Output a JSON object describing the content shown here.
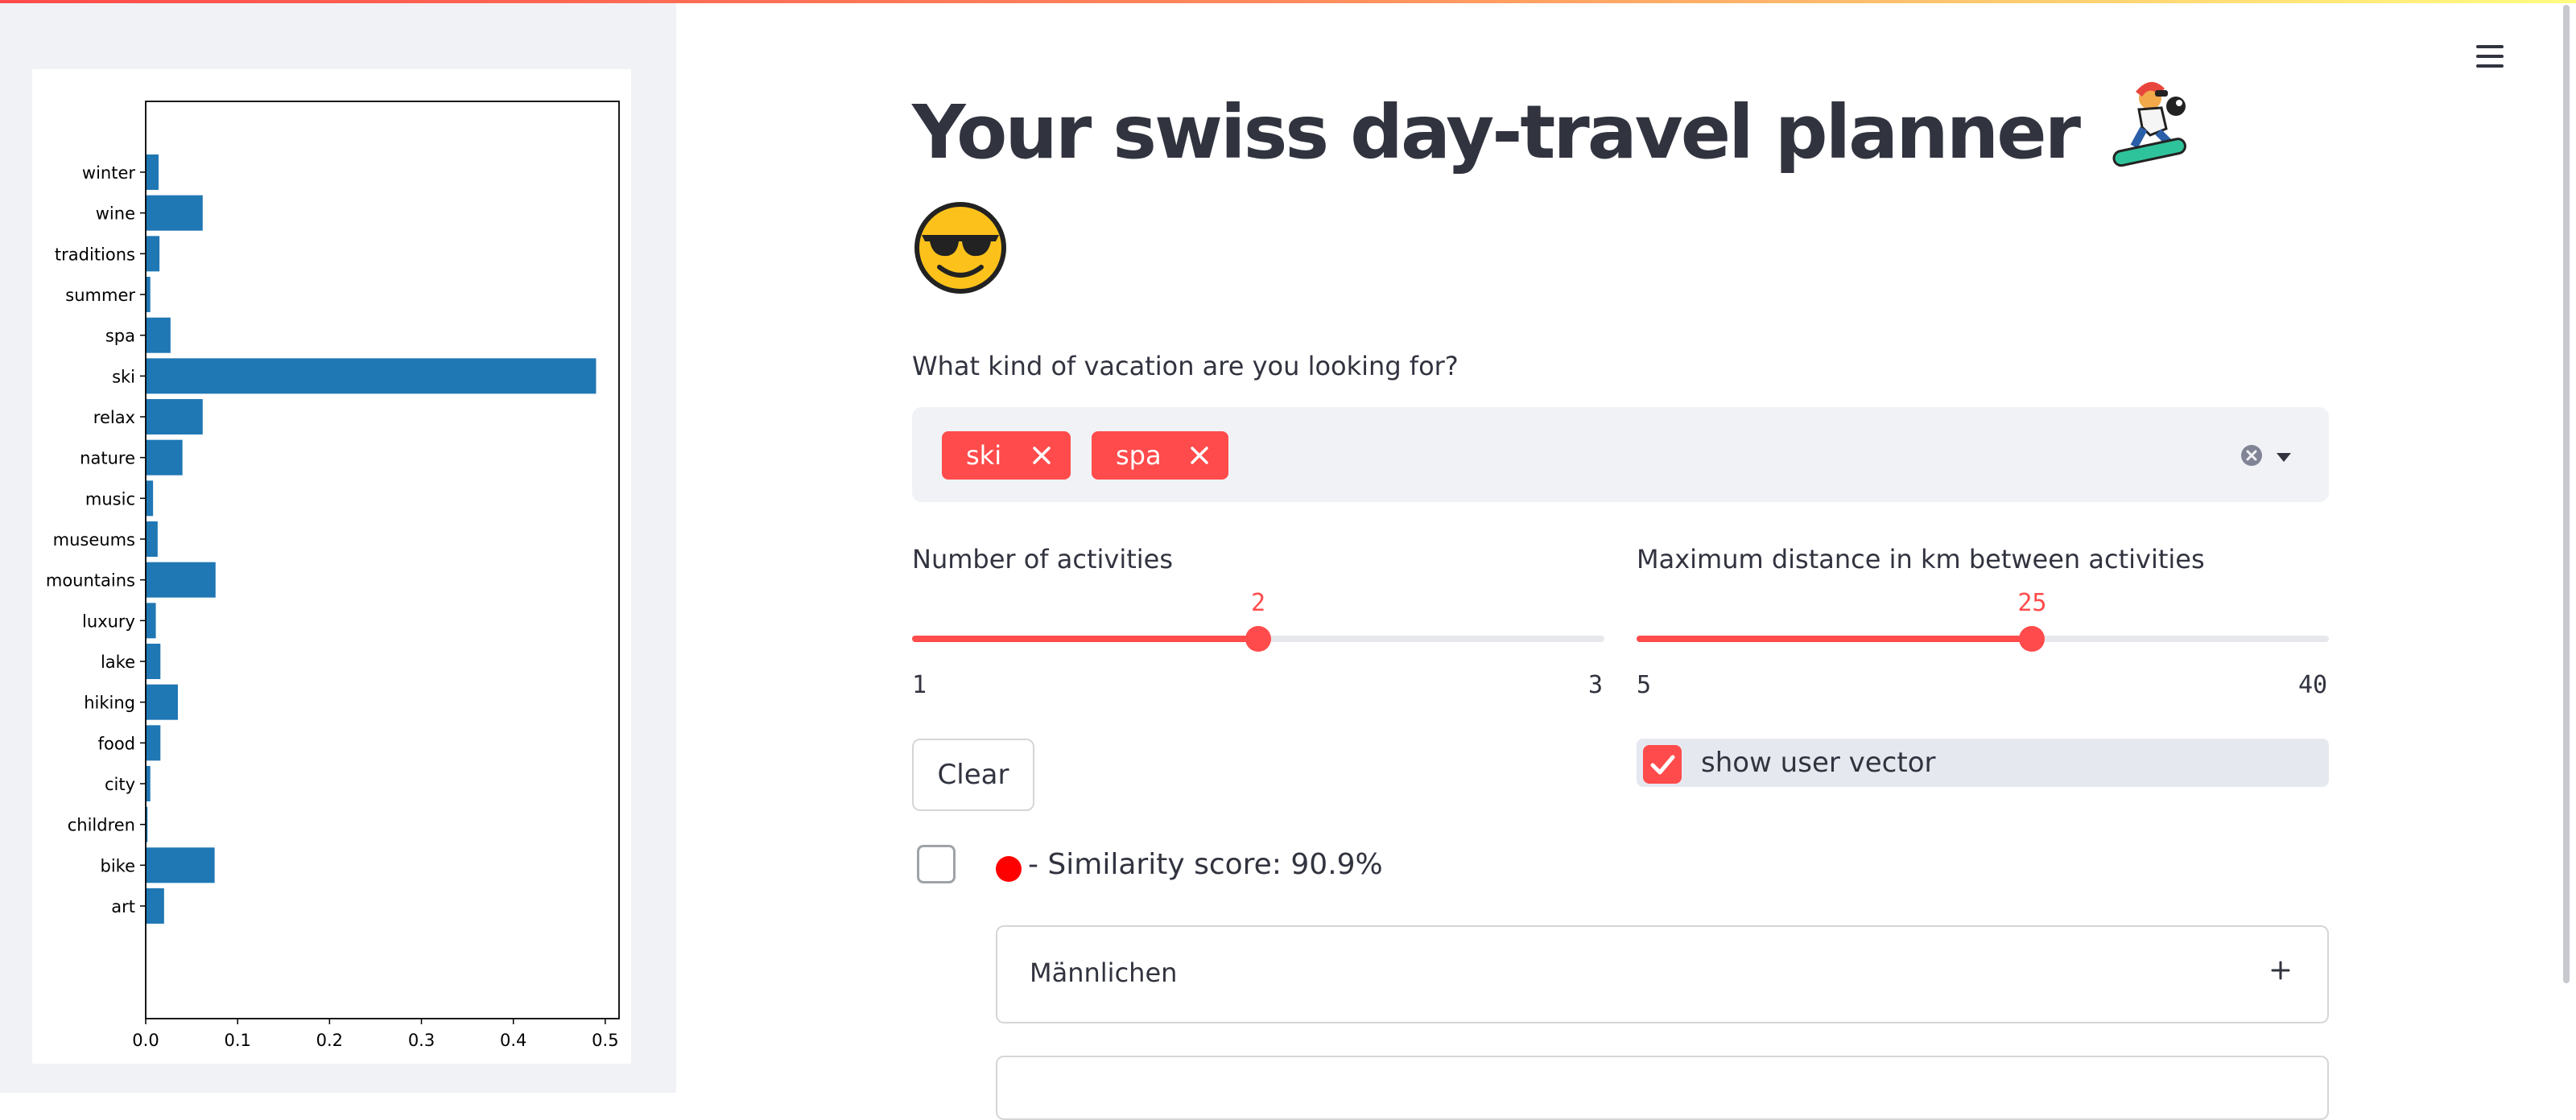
{
  "app": {
    "title": "Your swiss day-travel planner",
    "title_emoji_1": "snowboarder",
    "title_emoji_2": "smiling-face-with-sunglasses",
    "accent_color": "#ff4b4b"
  },
  "sidebar": {
    "chart_data": {
      "type": "bar",
      "orientation": "horizontal",
      "categories": [
        "winter",
        "wine",
        "traditions",
        "summer",
        "spa",
        "ski",
        "relax",
        "nature",
        "music",
        "museums",
        "mountains",
        "luxury",
        "lake",
        "hiking",
        "food",
        "city",
        "children",
        "bike",
        "art"
      ],
      "values": [
        0.014,
        0.062,
        0.015,
        0.005,
        0.027,
        0.49,
        0.062,
        0.04,
        0.008,
        0.013,
        0.076,
        0.011,
        0.016,
        0.035,
        0.016,
        0.005,
        0.002,
        0.075,
        0.02
      ],
      "xticks": [
        "0.0",
        "0.1",
        "0.2",
        "0.3",
        "0.4",
        "0.5"
      ],
      "xlim": [
        0,
        0.515
      ],
      "color": "#1f77b4",
      "title": "",
      "xlabel": "",
      "ylabel": ""
    }
  },
  "form": {
    "vacation_label": "What kind of vacation are you looking for?",
    "selected_tags": [
      "ski",
      "spa"
    ],
    "activities_slider": {
      "label": "Number of activities",
      "value": "2",
      "fraction": 0.5,
      "min": "1",
      "max": "3"
    },
    "distance_slider": {
      "label": "Maximum distance in km between activities",
      "value": "25",
      "fraction": 0.5714,
      "min": "5",
      "max": "40"
    },
    "clear_button": "Clear",
    "show_vector": {
      "label": "show user vector",
      "checked": true
    }
  },
  "results": [
    {
      "similarity": "- Similarity score: 90.9%",
      "name": "Männlichen",
      "dot_color": "#ff0000"
    }
  ],
  "icons": [
    "hamburger-menu-icon",
    "close-icon",
    "clear-circle-icon",
    "chevron-down-icon",
    "check-icon",
    "plus-icon"
  ]
}
